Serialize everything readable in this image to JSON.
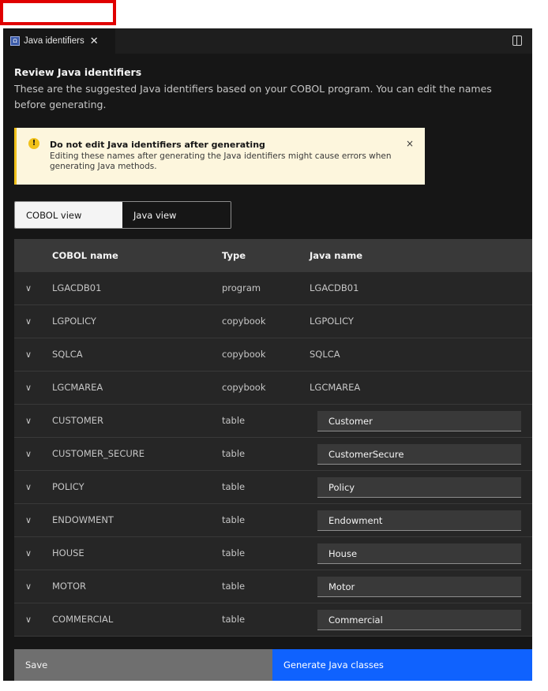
{
  "tab": {
    "label": "Java identifiers",
    "close": "✕",
    "icon": "code-file-icon",
    "icon_text": "Ω"
  },
  "title": "Review Java identifiers",
  "description": "These are the suggested Java identifiers based on your COBOL program. You can edit the names before generating.",
  "notification": {
    "title": "Do not edit Java identifiers after generating",
    "body": "Editing these names after generating the Java identifiers might cause errors when generating Java methods.",
    "icon": "!",
    "close": "×"
  },
  "switcher": {
    "cobol": "COBOL view",
    "java": "Java view"
  },
  "table": {
    "headers": {
      "name": "COBOL name",
      "type": "Type",
      "java": "Java name"
    },
    "rows": [
      {
        "name": "LGACDB01",
        "type": "program",
        "java": "LGACDB01"
      },
      {
        "name": "LGPOLICY",
        "type": "copybook",
        "java": "LGPOLICY"
      },
      {
        "name": "SQLCA",
        "type": "copybook",
        "java": "SQLCA"
      },
      {
        "name": "LGCMAREA",
        "type": "copybook",
        "java": "LGCMAREA"
      },
      {
        "name": "CUSTOMER",
        "type": "table",
        "java": "Customer"
      },
      {
        "name": "CUSTOMER_SECURE",
        "type": "table",
        "java": "CustomerSecure"
      },
      {
        "name": "POLICY",
        "type": "table",
        "java": "Policy"
      },
      {
        "name": "ENDOWMENT",
        "type": "table",
        "java": "Endowment"
      },
      {
        "name": "HOUSE",
        "type": "table",
        "java": "House"
      },
      {
        "name": "MOTOR",
        "type": "table",
        "java": "Motor"
      },
      {
        "name": "COMMERCIAL",
        "type": "table",
        "java": "Commercial"
      }
    ]
  },
  "buttons": {
    "save": "Save",
    "generate": "Generate Java classes"
  },
  "colors": {
    "highlight": "#e00000",
    "primary": "#0f62fe",
    "warning": "#f1c21b"
  }
}
